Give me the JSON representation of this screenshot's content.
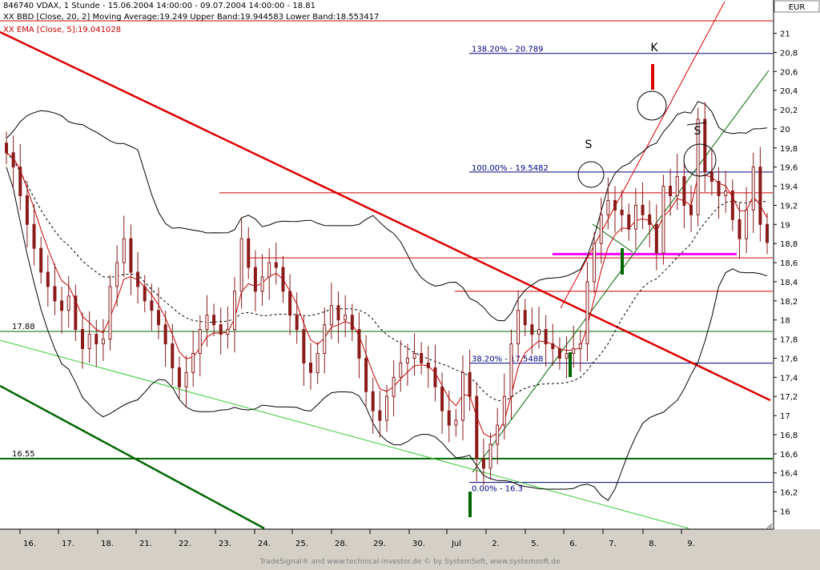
{
  "header": {
    "symbol_line": "846740  VDAX, 1 Stunde - 15.06.2004 14:00:00 - 09.07.2004 14:00:00 - 18.81",
    "bbd_line": "XX BBD [Close, 20, 2] Moving Average:19.249 Upper Band:19.944583 Lower Band:18.553417",
    "ema_line": "XX EMA [Close, 5]:19.041028"
  },
  "currency": "EUR",
  "footer": "TradeSignal® and www.technical-investor.de © by SystemSoft, www.systemsoft.de",
  "colors": {
    "price": "#8b1a1a",
    "bands": "#000000",
    "ema": "#cc0000",
    "trend_red": "#dd0000",
    "trend_green": "#006600",
    "light_green": "#33cc33",
    "fib": "#000080",
    "neckline": "#ff00ff",
    "plot_bg": "#ffffff",
    "panel_bg": "#d4d0c8"
  },
  "chart_data": {
    "type": "candlestick",
    "title": "846740 VDAX, 1 Stunde",
    "period": "15.06.2004 14:00:00 - 09.07.2004 14:00:00",
    "last": 18.81,
    "x_tick_labels": [
      "16.",
      "17.",
      "18.",
      "21.",
      "22.",
      "23.",
      "24.",
      "25.",
      "28.",
      "29.",
      "30.",
      "Jul",
      "2.",
      "5.",
      "6.",
      "7.",
      "8.",
      "9."
    ],
    "y_tick_labels": [
      "16",
      "16,2",
      "16,4",
      "16,6",
      "16,8",
      "17",
      "17,2",
      "17,4",
      "17,6",
      "17,8",
      "18",
      "18,2",
      "18,4",
      "18,6",
      "18,8",
      "19",
      "19,2",
      "19,4",
      "19,6",
      "19,8",
      "20",
      "20,2",
      "20,4",
      "20,6",
      "20,8",
      "21"
    ],
    "ylim": [
      15.9,
      21.2
    ],
    "indicators": {
      "bollinger": {
        "label": "BBD [Close, 20, 2]",
        "moving_average": 19.249,
        "upper_band": 19.944583,
        "lower_band": 18.553417
      },
      "ema": {
        "label": "EMA [Close, 5]",
        "value": 19.041028
      }
    },
    "fibonacci": [
      {
        "label": "138.20% - 20.789",
        "value": 20.789
      },
      {
        "label": "100.00% - 19.5482",
        "value": 19.5482
      },
      {
        "label": "38.20% - 17.5488",
        "value": 17.5488
      },
      {
        "label": "0.00% - 16.3",
        "value": 16.3
      }
    ],
    "horizontal_levels": [
      {
        "label": "17.88",
        "value": 17.88
      },
      {
        "label": "16.55",
        "value": 16.55
      }
    ],
    "pattern_labels": [
      "K",
      "S",
      "S"
    ],
    "closes": [
      19.75,
      19.6,
      19.3,
      19.0,
      18.75,
      18.5,
      18.35,
      18.2,
      18.1,
      18.25,
      17.9,
      17.7,
      17.85,
      17.75,
      17.8,
      18.35,
      18.6,
      18.85,
      18.5,
      18.35,
      18.2,
      18.1,
      17.95,
      17.75,
      17.5,
      17.3,
      17.45,
      17.65,
      17.9,
      18.05,
      17.95,
      17.85,
      17.9,
      18.3,
      18.85,
      18.55,
      18.3,
      18.45,
      18.6,
      18.55,
      18.3,
      18.05,
      17.9,
      17.55,
      17.45,
      17.65,
      17.95,
      18.15,
      18.0,
      18.05,
      17.9,
      17.6,
      17.25,
      17.05,
      16.95,
      17.2,
      17.4,
      17.55,
      17.6,
      17.65,
      17.55,
      17.5,
      17.3,
      17.05,
      16.9,
      16.95,
      17.45,
      17.2,
      16.55,
      16.45,
      16.7,
      16.9,
      17.2,
      17.75,
      18.1,
      17.95,
      17.85,
      17.9,
      17.75,
      17.7,
      17.6,
      17.65,
      17.7,
      17.75,
      18.4,
      18.8,
      19.1,
      19.25,
      19.15,
      19.1,
      18.95,
      19.2,
      19.1,
      19.0,
      18.7,
      19.4,
      19.3,
      19.5,
      19.2,
      19.1,
      20.1,
      19.55,
      19.45,
      19.3,
      19.35,
      19.05,
      18.85,
      19.15,
      19.6,
      19.0,
      18.81
    ]
  }
}
